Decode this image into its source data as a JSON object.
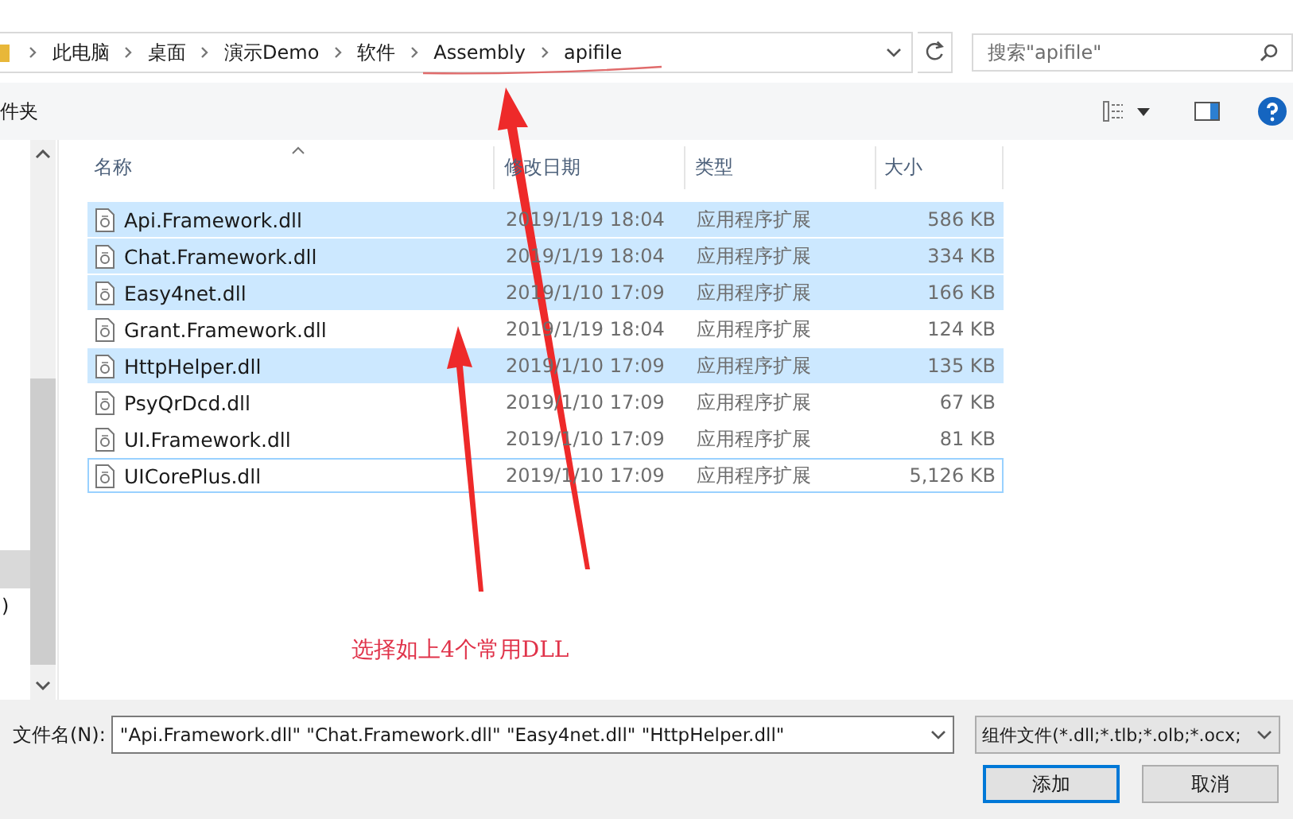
{
  "address_bar": {
    "breadcrumbs": [
      "此电脑",
      "桌面",
      "演示Demo",
      "软件",
      "Assembly",
      "apifile"
    ]
  },
  "search": {
    "placeholder": "搜索\"apifile\""
  },
  "toolbar": {
    "left_label": "件夹"
  },
  "nav_pane": {
    "items": [
      {
        "label": ")",
        "selected": false
      }
    ]
  },
  "file_list": {
    "columns": [
      {
        "label": "名称",
        "sorted": true
      },
      {
        "label": "修改日期",
        "sorted": false
      },
      {
        "label": "类型",
        "sorted": false
      },
      {
        "label": "大小",
        "sorted": false
      }
    ],
    "rows": [
      {
        "name": "Api.Framework.dll",
        "modified": "2019/1/19 18:04",
        "type": "应用程序扩展",
        "size": "586 KB",
        "selected": true,
        "focused": false
      },
      {
        "name": "Chat.Framework.dll",
        "modified": "2019/1/19 18:04",
        "type": "应用程序扩展",
        "size": "334 KB",
        "selected": true,
        "focused": false
      },
      {
        "name": "Easy4net.dll",
        "modified": "2019/1/10 17:09",
        "type": "应用程序扩展",
        "size": "166 KB",
        "selected": true,
        "focused": false
      },
      {
        "name": "Grant.Framework.dll",
        "modified": "2019/1/19 18:04",
        "type": "应用程序扩展",
        "size": "124 KB",
        "selected": false,
        "focused": false
      },
      {
        "name": "HttpHelper.dll",
        "modified": "2019/1/10 17:09",
        "type": "应用程序扩展",
        "size": "135 KB",
        "selected": true,
        "focused": false
      },
      {
        "name": "PsyQrDcd.dll",
        "modified": "2019/1/10 17:09",
        "type": "应用程序扩展",
        "size": "67 KB",
        "selected": false,
        "focused": false
      },
      {
        "name": "UI.Framework.dll",
        "modified": "2019/1/10 17:09",
        "type": "应用程序扩展",
        "size": "81 KB",
        "selected": false,
        "focused": false
      },
      {
        "name": "UICorePlus.dll",
        "modified": "2019/1/10 17:09",
        "type": "应用程序扩展",
        "size": "5,126 KB",
        "selected": false,
        "focused": true
      }
    ]
  },
  "annotation": {
    "text": "选择如上4个常用DLL"
  },
  "footer": {
    "filename_label": "文件名(N):",
    "filename_value": "\"Api.Framework.dll\" \"Chat.Framework.dll\" \"Easy4net.dll\" \"HttpHelper.dll\"",
    "filter": "组件文件(*.dll;*.tlb;*.olb;*.ocx;",
    "buttons": [
      {
        "label": "添加",
        "default": true
      },
      {
        "label": "取消",
        "default": false
      }
    ]
  }
}
